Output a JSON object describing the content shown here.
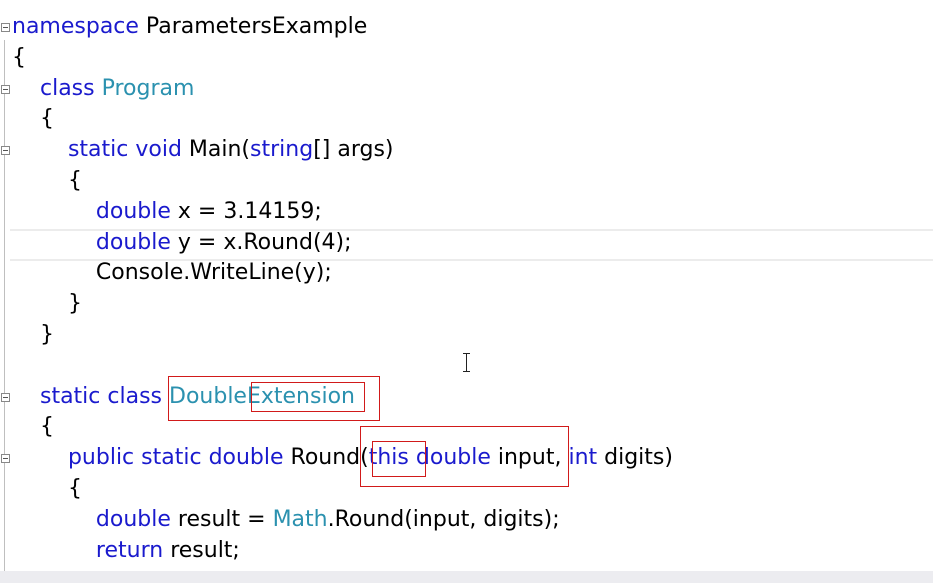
{
  "editor": {
    "lines": [
      {
        "tokens": [
          {
            "t": "namespace",
            "c": "kw"
          },
          {
            "t": " ParametersExample",
            "c": ""
          }
        ]
      },
      {
        "tokens": [
          {
            "t": "{",
            "c": ""
          }
        ]
      },
      {
        "tokens": [
          {
            "t": "    ",
            "c": ""
          },
          {
            "t": "class",
            "c": "kw"
          },
          {
            "t": " ",
            "c": ""
          },
          {
            "t": "Program",
            "c": "type"
          }
        ]
      },
      {
        "tokens": [
          {
            "t": "    {",
            "c": ""
          }
        ]
      },
      {
        "tokens": [
          {
            "t": "        ",
            "c": ""
          },
          {
            "t": "static",
            "c": "kw"
          },
          {
            "t": " ",
            "c": ""
          },
          {
            "t": "void",
            "c": "kw"
          },
          {
            "t": " Main(",
            "c": ""
          },
          {
            "t": "string",
            "c": "kw"
          },
          {
            "t": "[] args)",
            "c": ""
          }
        ]
      },
      {
        "tokens": [
          {
            "t": "        {",
            "c": ""
          }
        ]
      },
      {
        "tokens": [
          {
            "t": "            ",
            "c": ""
          },
          {
            "t": "double",
            "c": "kw"
          },
          {
            "t": " x = 3.14159;",
            "c": ""
          }
        ]
      },
      {
        "tokens": [
          {
            "t": "            ",
            "c": ""
          },
          {
            "t": "double",
            "c": "kw"
          },
          {
            "t": " y = x.Round(4);",
            "c": ""
          }
        ]
      },
      {
        "tokens": [
          {
            "t": "            Console.WriteLine(y);",
            "c": ""
          }
        ]
      },
      {
        "tokens": [
          {
            "t": "        }",
            "c": ""
          }
        ]
      },
      {
        "tokens": [
          {
            "t": "    }",
            "c": ""
          }
        ]
      },
      {
        "tokens": [
          {
            "t": "",
            "c": ""
          }
        ]
      },
      {
        "tokens": [
          {
            "t": "    ",
            "c": ""
          },
          {
            "t": "static",
            "c": "kw"
          },
          {
            "t": " ",
            "c": ""
          },
          {
            "t": "class",
            "c": "kw"
          },
          {
            "t": " ",
            "c": ""
          },
          {
            "t": "DoubleExtension",
            "c": "type"
          }
        ]
      },
      {
        "tokens": [
          {
            "t": "    {",
            "c": ""
          }
        ]
      },
      {
        "tokens": [
          {
            "t": "        ",
            "c": ""
          },
          {
            "t": "public",
            "c": "kw"
          },
          {
            "t": " ",
            "c": ""
          },
          {
            "t": "static",
            "c": "kw"
          },
          {
            "t": " ",
            "c": ""
          },
          {
            "t": "double",
            "c": "kw"
          },
          {
            "t": " Round(",
            "c": ""
          },
          {
            "t": "this",
            "c": "kw"
          },
          {
            "t": " ",
            "c": ""
          },
          {
            "t": "double",
            "c": "kw"
          },
          {
            "t": " input, ",
            "c": ""
          },
          {
            "t": "int",
            "c": "kw"
          },
          {
            "t": " digits)",
            "c": ""
          }
        ]
      },
      {
        "tokens": [
          {
            "t": "        {",
            "c": ""
          }
        ]
      },
      {
        "tokens": [
          {
            "t": "            ",
            "c": ""
          },
          {
            "t": "double",
            "c": "kw"
          },
          {
            "t": " result = ",
            "c": ""
          },
          {
            "t": "Math",
            "c": "type"
          },
          {
            "t": ".Round(input, digits);",
            "c": ""
          }
        ]
      },
      {
        "tokens": [
          {
            "t": "            ",
            "c": ""
          },
          {
            "t": "return",
            "c": "kw"
          },
          {
            "t": " result;",
            "c": ""
          }
        ]
      }
    ],
    "fold_markers": [
      0,
      2,
      4,
      12,
      14
    ],
    "current_line": 7
  },
  "colors": {
    "keyword": "#1a1acd",
    "type": "#2b91af",
    "highlight_box": "#d11a1a"
  }
}
